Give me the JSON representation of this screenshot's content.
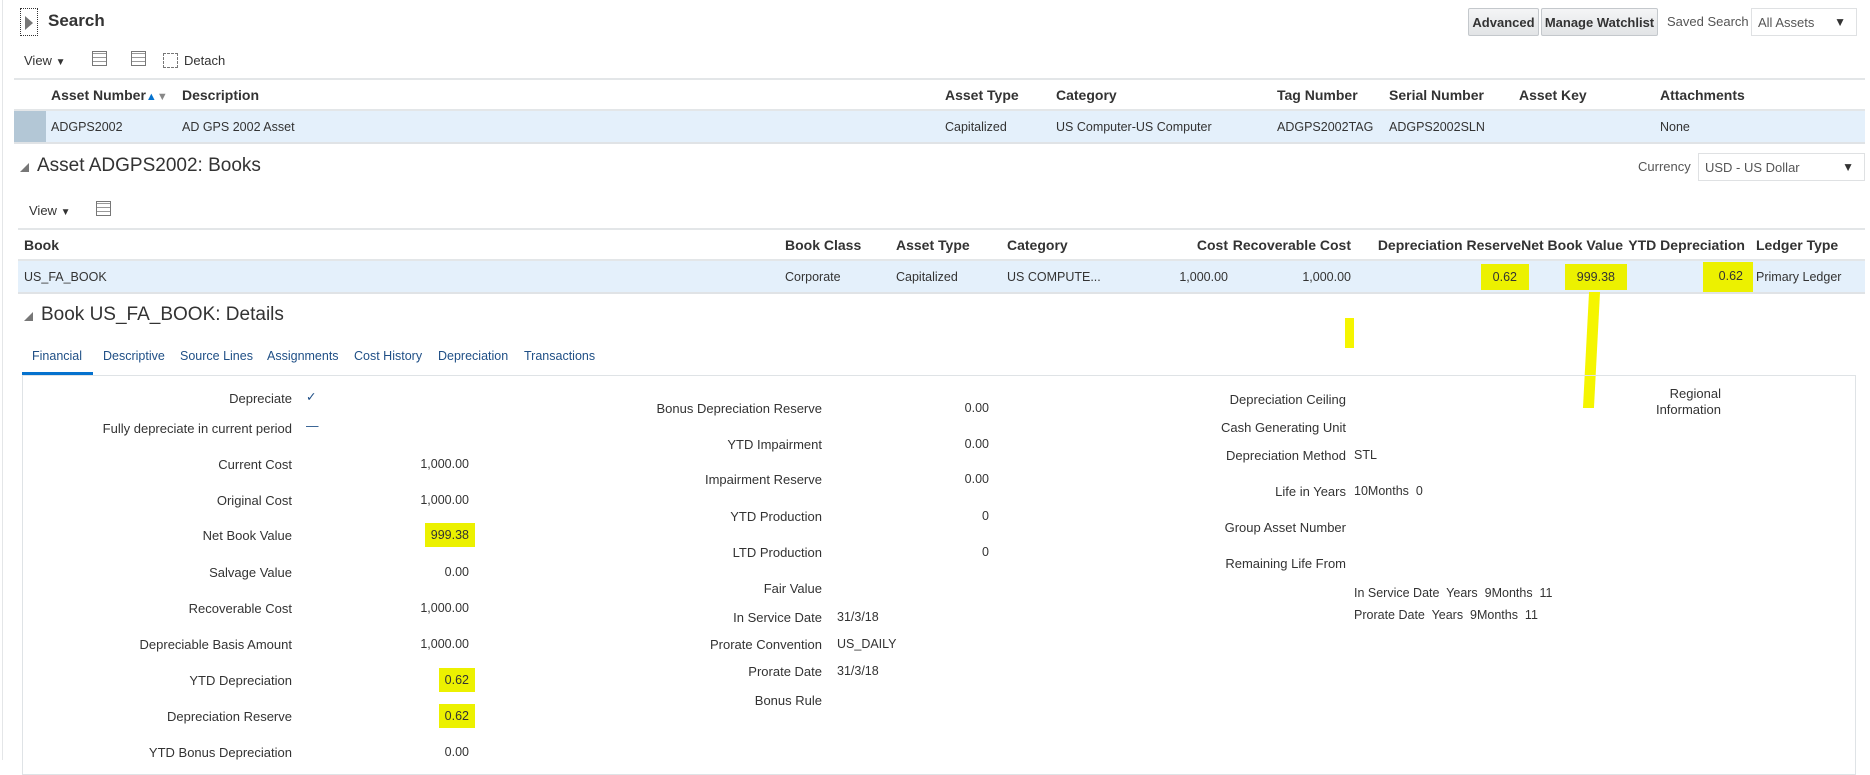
{
  "search": {
    "title": "Search",
    "advanced": "Advanced",
    "manage_watchlist": "Manage Watchlist",
    "saved_search_label": "Saved Search",
    "saved_search_value": "All Assets"
  },
  "toolbar": {
    "view": "View",
    "detach": "Detach"
  },
  "assets_table": {
    "columns": [
      "Asset Number",
      "Description",
      "Asset Type",
      "Category",
      "Tag Number",
      "Serial Number",
      "Asset Key",
      "Attachments"
    ],
    "rows": [
      [
        "ADGPS2002",
        "AD GPS 2002 Asset",
        "Capitalized",
        "US Computer-US Computer",
        "ADGPS2002TAG",
        "ADGPS2002SLN",
        "",
        "None"
      ]
    ]
  },
  "books": {
    "title": "Asset ADGPS2002: Books",
    "currency_label": "Currency",
    "currency_value": "USD - US Dollar",
    "view": "View",
    "columns": [
      "Book",
      "Book Class",
      "Asset Type",
      "Category",
      "Cost",
      "Recoverable Cost",
      "Depreciation Reserve",
      "Net Book Value",
      "YTD Depreciation",
      "Ledger Type"
    ],
    "rows": [
      [
        "US_FA_BOOK",
        "Corporate",
        "Capitalized",
        "US COMPUTE...",
        "1,000.00",
        "1,000.00",
        "0.62",
        "999.38",
        "0.62",
        "Primary Ledger"
      ]
    ]
  },
  "details": {
    "title": "Book US_FA_BOOK: Details",
    "tabs": [
      "Financial",
      "Descriptive",
      "Source Lines",
      "Assignments",
      "Cost History",
      "Depreciation",
      "Transactions"
    ],
    "active_tab": "Financial",
    "col1": [
      {
        "label": "Depreciate",
        "value": "✓"
      },
      {
        "label": "Fully depreciate in current period",
        "value": "—"
      },
      {
        "label": "Current Cost",
        "value": "1,000.00"
      },
      {
        "label": "Original Cost",
        "value": "1,000.00"
      },
      {
        "label": "Net Book Value",
        "value": "999.38"
      },
      {
        "label": "Salvage Value",
        "value": "0.00"
      },
      {
        "label": "Recoverable Cost",
        "value": "1,000.00"
      },
      {
        "label": "Depreciable Basis Amount",
        "value": "1,000.00"
      },
      {
        "label": "YTD Depreciation",
        "value": "0.62"
      },
      {
        "label": "Depreciation Reserve",
        "value": "0.62"
      },
      {
        "label": "YTD Bonus Depreciation",
        "value": "0.00"
      }
    ],
    "col2": [
      {
        "label": "Bonus Depreciation Reserve",
        "value": "0.00"
      },
      {
        "label": "YTD Impairment",
        "value": "0.00"
      },
      {
        "label": "Impairment Reserve",
        "value": "0.00"
      },
      {
        "label": "YTD Production",
        "value": "0"
      },
      {
        "label": "LTD Production",
        "value": "0"
      },
      {
        "label": "Fair Value",
        "value": ""
      },
      {
        "label": "In Service Date",
        "value": "31/3/18"
      },
      {
        "label": "Prorate Convention",
        "value": "US_DAILY"
      },
      {
        "label": "Prorate Date",
        "value": "31/3/18"
      },
      {
        "label": "Bonus Rule",
        "value": ""
      }
    ],
    "col3": [
      {
        "label": "Depreciation Ceiling",
        "value": ""
      },
      {
        "label": "Cash Generating Unit",
        "value": ""
      },
      {
        "label": "Depreciation Method",
        "value": "STL"
      },
      {
        "label": "Life in Years",
        "value": "10Months  0"
      },
      {
        "label": "Group Asset Number",
        "value": ""
      },
      {
        "label": "Remaining Life From",
        "value": ""
      }
    ],
    "remaining": [
      "In Service Date  Years  9Months  11",
      "Prorate Date  Years  9Months  11"
    ],
    "regional": "Regional\nInformation"
  },
  "colors": {
    "highlight": "#ecf100",
    "row_selected": "#e4f0fb",
    "tab_active": "#0572ce",
    "link": "#1f4f86"
  }
}
